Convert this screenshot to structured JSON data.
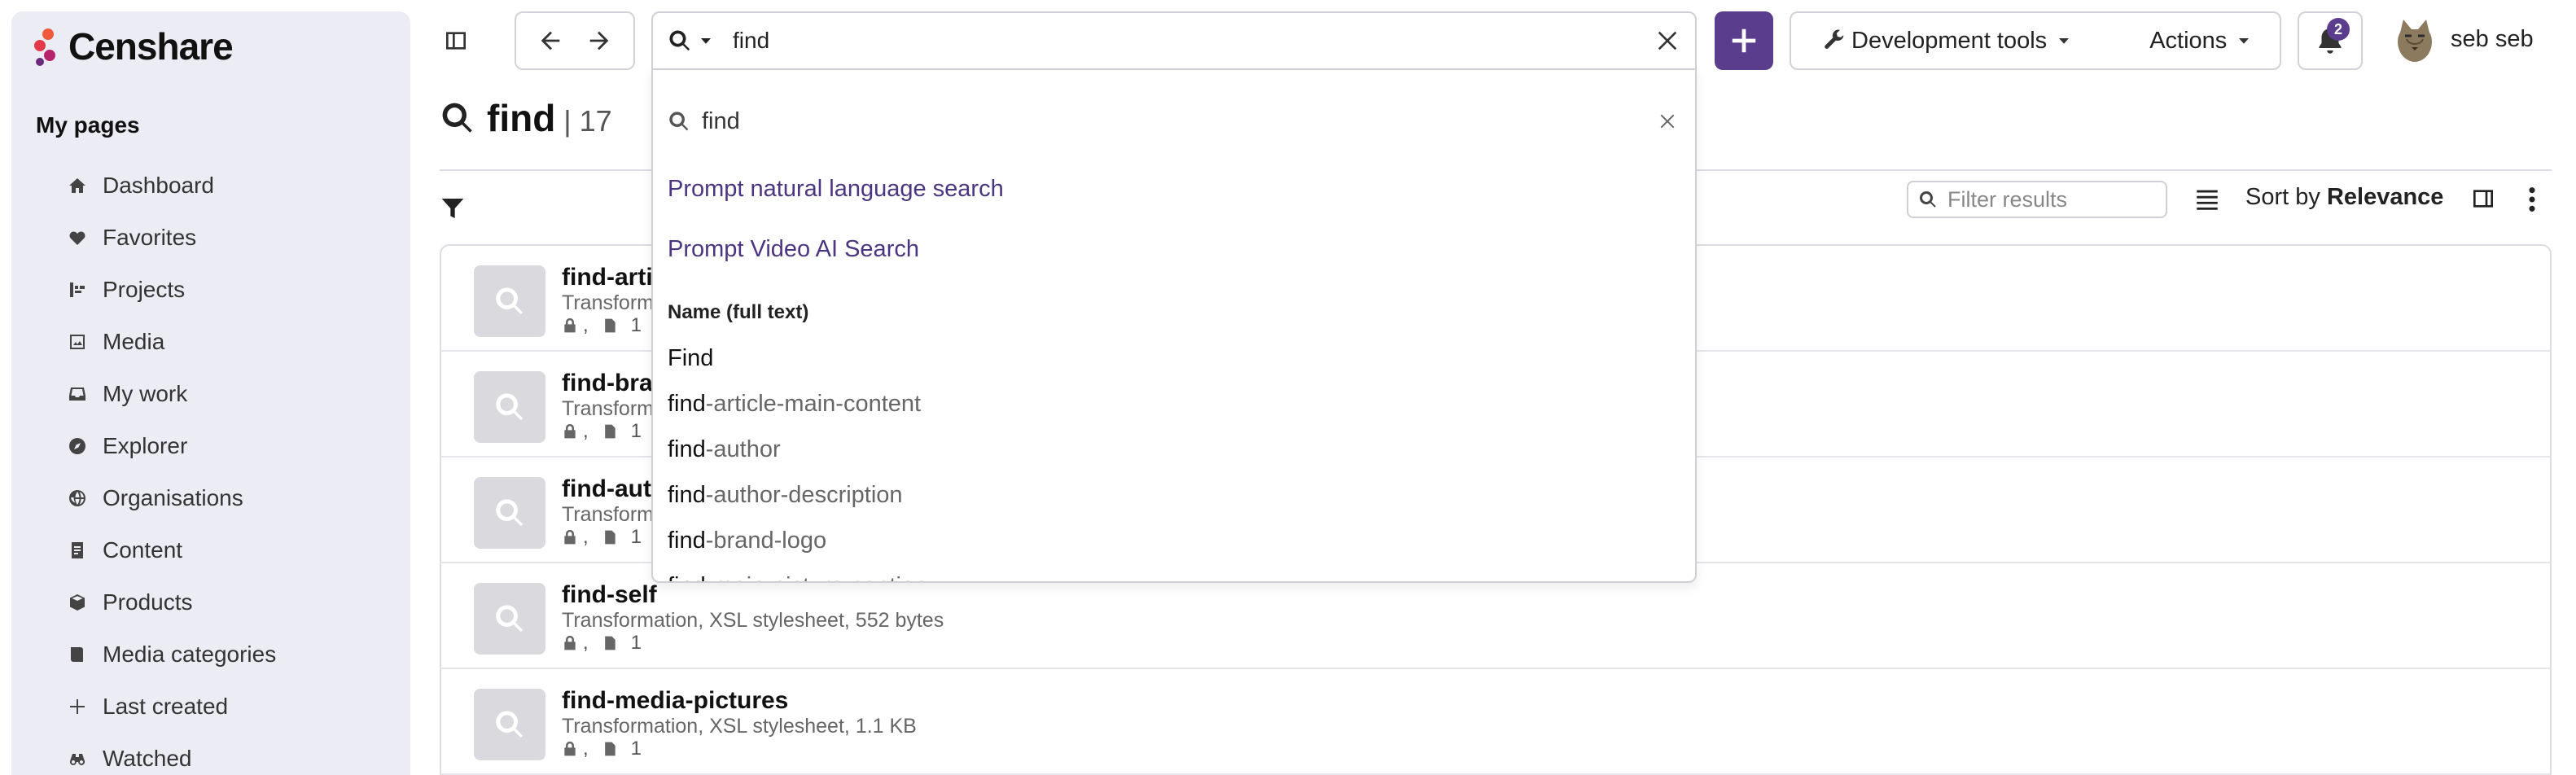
{
  "brand": {
    "name": "Censhare",
    "accent": "#5a3d8c"
  },
  "sidebar": {
    "title": "My pages",
    "items": [
      {
        "label": "Dashboard",
        "icon": "home-icon"
      },
      {
        "label": "Favorites",
        "icon": "heart-icon"
      },
      {
        "label": "Projects",
        "icon": "projects-icon"
      },
      {
        "label": "Media",
        "icon": "image-icon"
      },
      {
        "label": "My work",
        "icon": "inbox-icon"
      },
      {
        "label": "Explorer",
        "icon": "compass-icon"
      },
      {
        "label": "Organisations",
        "icon": "globe-icon"
      },
      {
        "label": "Content",
        "icon": "document-icon"
      },
      {
        "label": "Products",
        "icon": "box-icon"
      },
      {
        "label": "Media categories",
        "icon": "book-icon"
      },
      {
        "label": "Last created",
        "icon": "plus-icon"
      },
      {
        "label": "Watched",
        "icon": "binoculars-icon"
      }
    ]
  },
  "toolbar": {
    "search_value": "find",
    "dev_tools_label": "Development tools",
    "actions_label": "Actions",
    "notification_count": "2",
    "user_name": "seb seb"
  },
  "page": {
    "title": "find",
    "count": "| 17",
    "filter_placeholder": "Filter results",
    "sort_prefix": "Sort by",
    "sort_value": "Relevance"
  },
  "results": [
    {
      "title": "find-arti",
      "sub": "Transform",
      "count": "1"
    },
    {
      "title": "find-bra",
      "sub": "Transform",
      "count": "1"
    },
    {
      "title": "find-aut",
      "sub": "Transform",
      "count": "1"
    },
    {
      "title": "find-self",
      "sub": "Transformation,  XSL stylesheet,  552 bytes",
      "count": "1"
    },
    {
      "title": "find-media-pictures",
      "sub": "Transformation,  XSL stylesheet,  1.1 KB",
      "count": "1"
    }
  ],
  "dropdown": {
    "search_value": "find",
    "links": [
      "Prompt natural language search",
      "Prompt Video AI Search"
    ],
    "section_title": "Name (full text)",
    "items": [
      {
        "match": "Find",
        "rest": ""
      },
      {
        "match": "find",
        "rest": "-article-main-content"
      },
      {
        "match": "find",
        "rest": "-author"
      },
      {
        "match": "find",
        "rest": "-author-description"
      },
      {
        "match": "find",
        "rest": "-brand-logo"
      },
      {
        "match": "find",
        "rest": "-main-picture-caption"
      }
    ]
  }
}
